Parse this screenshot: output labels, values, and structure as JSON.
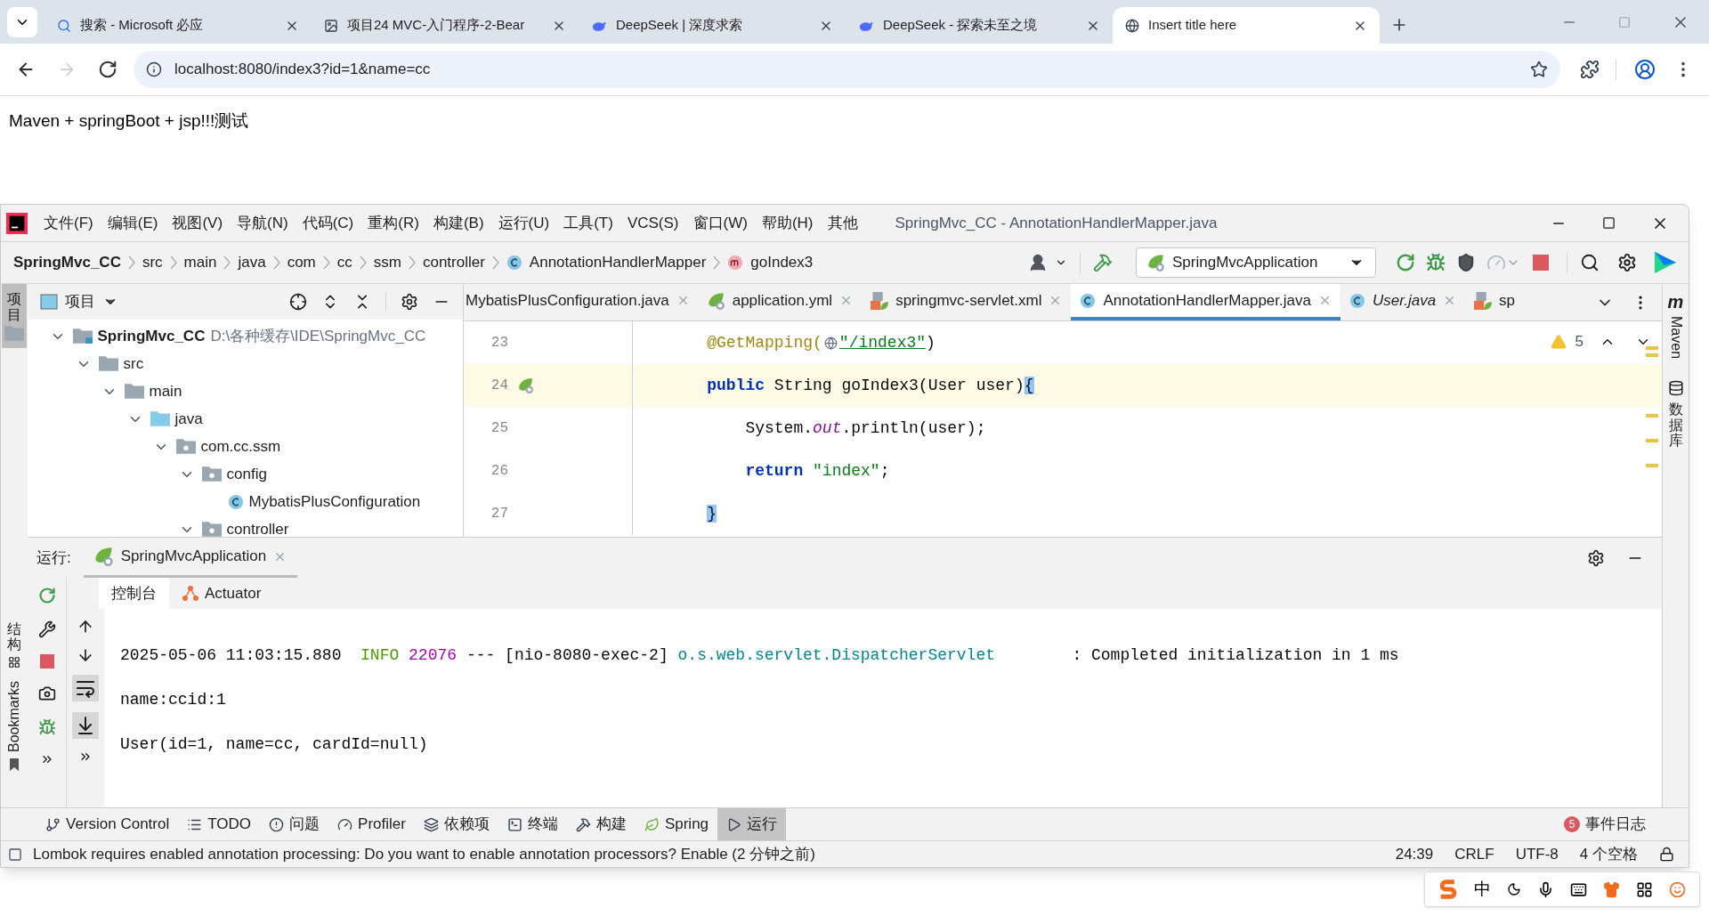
{
  "browser": {
    "tabs": [
      {
        "title": "搜索 - Microsoft 必应",
        "kind": "search",
        "selected": false
      },
      {
        "title": "项目24 MVC-入门程序-2-Bear",
        "kind": "image",
        "selected": false
      },
      {
        "title": "DeepSeek | 深度求索",
        "kind": "whale",
        "selected": false
      },
      {
        "title": "DeepSeek - 探索未至之境",
        "kind": "whale",
        "selected": false
      },
      {
        "title": "Insert title here",
        "kind": "globe",
        "selected": true
      }
    ],
    "nav": [
      {
        "kind": "back",
        "disabled": false
      },
      {
        "kind": "forward",
        "disabled": true
      },
      {
        "kind": "reload",
        "disabled": false
      }
    ],
    "url": "localhost:8080/index3?id=1&name=cc"
  },
  "page": {
    "text": "Maven + springBoot + jsp!!!测试"
  },
  "ide": {
    "menu": [
      "文件(F)",
      "编辑(E)",
      "视图(V)",
      "导航(N)",
      "代码(C)",
      "重构(R)",
      "构建(B)",
      "运行(U)",
      "工具(T)",
      "VCS(S)",
      "窗口(W)",
      "帮助(H)",
      "其他"
    ],
    "title": "SpringMvc_CC - AnnotationHandlerMapper.java",
    "breadcrumb": [
      {
        "text": "SpringMvc_CC",
        "kind": "project"
      },
      {
        "text": "src",
        "kind": "plain"
      },
      {
        "text": "main",
        "kind": "plain"
      },
      {
        "text": "java",
        "kind": "plain"
      },
      {
        "text": "com",
        "kind": "plain"
      },
      {
        "text": "cc",
        "kind": "plain"
      },
      {
        "text": "ssm",
        "kind": "plain"
      },
      {
        "text": "controller",
        "kind": "plain"
      },
      {
        "text": "AnnotationHandlerMapper",
        "kind": "class"
      },
      {
        "text": "goIndex3",
        "kind": "method"
      }
    ],
    "run_config": "SpringMvcApplication",
    "toolbar": [
      {
        "kind": "rerun",
        "disabled": false
      },
      {
        "kind": "debug",
        "disabled": false
      },
      {
        "kind": "coverage",
        "disabled": false
      },
      {
        "kind": "profile",
        "disabled": true
      },
      {
        "kind": "stop",
        "disabled": false
      }
    ],
    "left_strip": {
      "top": {
        "label": "项目",
        "selected": true
      },
      "structure": "结构",
      "bookmarks": "Bookmarks"
    },
    "project": {
      "title": "项目",
      "tree": [
        {
          "name": "SpringMvc_CC",
          "path": "D:\\各种缓存\\IDE\\SpringMvc_CC",
          "kind": "module",
          "expanded": true,
          "children": [
            {
              "name": "src",
              "kind": "folder",
              "expanded": true,
              "children": [
                {
                  "name": "main",
                  "kind": "folder",
                  "expanded": true,
                  "children": [
                    {
                      "name": "java",
                      "kind": "source",
                      "expanded": true,
                      "children": [
                        {
                          "name": "com.cc.ssm",
                          "kind": "package",
                          "expanded": true,
                          "children": [
                            {
                              "name": "config",
                              "kind": "package",
                              "expanded": true,
                              "children": [
                                {
                                  "name": "MybatisPlusConfiguration",
                                  "kind": "class"
                                }
                              ]
                            },
                            {
                              "name": "controller",
                              "kind": "package",
                              "expanded": true
                            }
                          ]
                        }
                      ]
                    }
                  ]
                }
              ]
            }
          ]
        }
      ]
    },
    "editor_tabs": [
      {
        "title": "MybatisPlusConfiguration.java",
        "italic": false,
        "selected": false
      },
      {
        "title": "application.yml",
        "kind": "yml",
        "italic": false,
        "selected": false
      },
      {
        "title": "springmvc-servlet.xml",
        "kind": "xml",
        "italic": false,
        "selected": false
      },
      {
        "title": "AnnotationHandlerMapper.java",
        "kind": "class",
        "italic": false,
        "selected": true
      },
      {
        "title": "User.java",
        "kind": "class",
        "italic": true,
        "selected": false
      },
      {
        "title": "sp",
        "kind": "xml",
        "italic": false,
        "selected": false
      }
    ],
    "warnings": "5",
    "code": [
      {
        "number": "23",
        "current": false,
        "bean": false,
        "tokens": [
          {
            "kind": "annotation",
            "text": "    @GetMapping("
          },
          {
            "kind": "url-icon"
          },
          {
            "kind": "url",
            "text": "\"/index3\""
          },
          {
            "kind": "plain",
            "text": ")"
          }
        ]
      },
      {
        "number": "24",
        "current": true,
        "bean": true,
        "tokens": [
          {
            "kind": "keyword",
            "text": "    public"
          },
          {
            "kind": "plain",
            "text": " String goIndex3(User user)"
          },
          {
            "kind": "brace-match",
            "text": "{"
          }
        ]
      },
      {
        "number": "25",
        "current": false,
        "bean": false,
        "tokens": [
          {
            "kind": "plain",
            "text": "        System."
          },
          {
            "kind": "static",
            "text": "out"
          },
          {
            "kind": "plain",
            "text": ".println(user);"
          }
        ]
      },
      {
        "number": "26",
        "current": false,
        "bean": false,
        "tokens": [
          {
            "kind": "keyword",
            "text": "        return"
          },
          {
            "kind": "string",
            "text": " \"index\""
          },
          {
            "kind": "plain",
            "text": ";"
          }
        ]
      },
      {
        "number": "27",
        "current": false,
        "bean": false,
        "tokens": [
          {
            "kind": "brace-match",
            "text": "    }"
          }
        ]
      }
    ],
    "right_strip": [
      {
        "label": "Maven",
        "glyph": "m"
      },
      {
        "label": "数据库"
      }
    ],
    "run": {
      "label": "运行:",
      "tab": "SpringMvcApplication",
      "subtabs": [
        {
          "label": "控制台",
          "selected": true
        },
        {
          "label": "Actuator",
          "selected": false
        }
      ],
      "console": [
        [
          {
            "kind": "plain",
            "text": "2025-05-06 11:03:15.880  "
          },
          {
            "kind": "info",
            "text": "INFO "
          },
          {
            "kind": "pid",
            "text": "22076"
          },
          {
            "kind": "plain",
            "text": " --- [nio-8080-exec-2] "
          },
          {
            "kind": "logger",
            "text": "o.s.web.servlet.DispatcherServlet"
          },
          {
            "kind": "plain",
            "text": "        : Completed initialization in 1 ms"
          }
        ],
        [
          {
            "kind": "plain",
            "text": "name:ccid:1"
          }
        ],
        [
          {
            "kind": "plain",
            "text": "User(id=1, name=cc, cardId=null)"
          }
        ]
      ]
    },
    "bottom_tools": [
      {
        "label": "Version Control",
        "kind": "branch",
        "selected": false
      },
      {
        "label": "TODO",
        "kind": "list",
        "selected": false
      },
      {
        "label": "问题",
        "kind": "alert",
        "selected": false
      },
      {
        "label": "Profiler",
        "kind": "profiler",
        "selected": false
      },
      {
        "label": "依赖项",
        "kind": "layers",
        "selected": false
      },
      {
        "label": "终端",
        "kind": "terminal",
        "selected": false
      },
      {
        "label": "构建",
        "kind": "hammer",
        "selected": false
      },
      {
        "label": "Spring",
        "kind": "leaf",
        "selected": false
      },
      {
        "label": "运行",
        "kind": "play",
        "selected": true
      }
    ],
    "event_log": {
      "count": "5",
      "label": "事件日志"
    },
    "status": {
      "message": "Lombok requires enabled annotation processing: Do you want to enable annotation processors? Enable (2 分钟之前)",
      "items": [
        "24:39",
        "CRLF",
        "UTF-8",
        "4 个空格"
      ]
    }
  },
  "ime": {
    "mode": "中"
  }
}
